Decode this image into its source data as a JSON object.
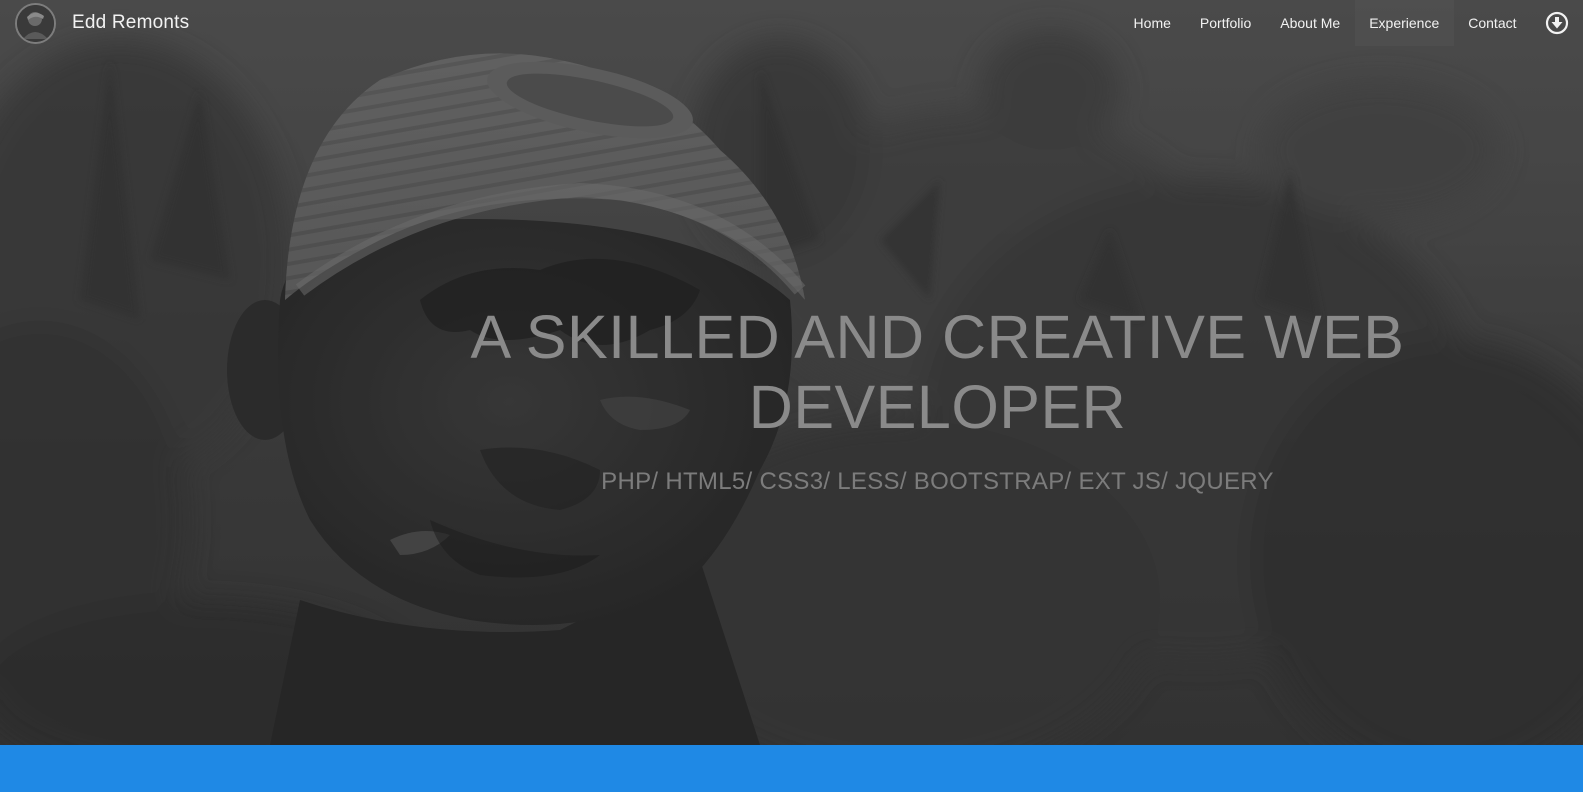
{
  "brand": {
    "name": "Edd Remonts"
  },
  "nav": {
    "items": [
      {
        "label": "Home"
      },
      {
        "label": "Portfolio"
      },
      {
        "label": "About Me"
      },
      {
        "label": "Experience"
      },
      {
        "label": "Contact"
      }
    ],
    "download_icon": "circle-arrow-down-icon"
  },
  "hero": {
    "title": "A SKILLED AND CREATIVE WEB DEVELOPER",
    "subtitle": "PHP/ HTML5/ CSS3/ LESS/ BOOTSTRAP/ EXT JS/ JQUERY"
  },
  "colors": {
    "accent_band": "#1f89e5",
    "nav_text": "#f2f2f2",
    "hero_text": "#8a8a8a"
  }
}
